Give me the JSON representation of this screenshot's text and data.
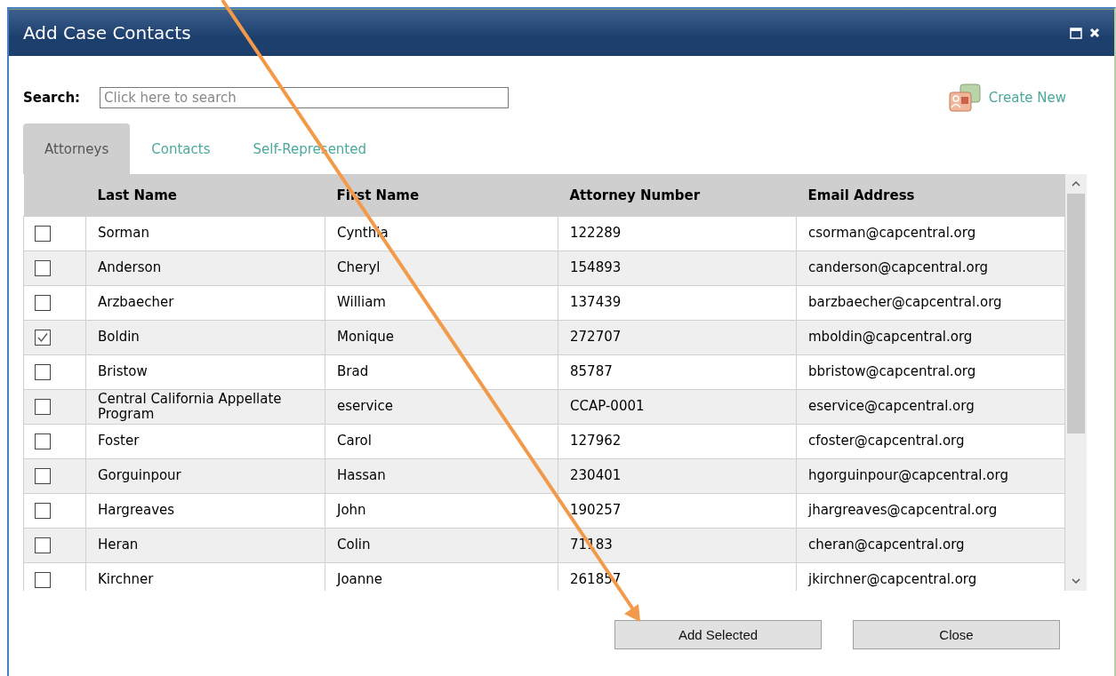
{
  "window": {
    "title": "Add Case Contacts"
  },
  "search": {
    "label": "Search:",
    "placeholder": "Click here to search"
  },
  "create_new": {
    "label": "Create New"
  },
  "tabs": [
    {
      "label": "Attorneys",
      "selected": true
    },
    {
      "label": "Contacts",
      "selected": false
    },
    {
      "label": "Self-Represented",
      "selected": false
    }
  ],
  "table": {
    "columns": [
      "Last Name",
      "First Name",
      "Attorney Number",
      "Email Address"
    ],
    "rows": [
      {
        "checked": false,
        "cells": [
          "Sorman",
          "Cynthia",
          "122289",
          "csorman@capcentral.org"
        ]
      },
      {
        "checked": false,
        "cells": [
          "Anderson",
          "Cheryl",
          "154893",
          "canderson@capcentral.org"
        ]
      },
      {
        "checked": false,
        "cells": [
          "Arzbaecher",
          "William",
          "137439",
          "barzbaecher@capcentral.org"
        ]
      },
      {
        "checked": true,
        "cells": [
          "Boldin",
          "Monique",
          "272707",
          "mboldin@capcentral.org"
        ]
      },
      {
        "checked": false,
        "cells": [
          "Bristow",
          "Brad",
          "85787",
          "bbristow@capcentral.org"
        ]
      },
      {
        "checked": false,
        "cells": [
          "Central California Appellate Program",
          "eservice",
          "CCAP-0001",
          "eservice@capcentral.org"
        ]
      },
      {
        "checked": false,
        "cells": [
          "Foster",
          "Carol",
          "127962",
          "cfoster@capcentral.org"
        ]
      },
      {
        "checked": false,
        "cells": [
          "Gorguinpour",
          "Hassan",
          "230401",
          "hgorguinpour@capcentral.org"
        ]
      },
      {
        "checked": false,
        "cells": [
          "Hargreaves",
          "John",
          "190257",
          "jhargreaves@capcentral.org"
        ]
      },
      {
        "checked": false,
        "cells": [
          "Heran",
          "Colin",
          "71183",
          "cheran@capcentral.org"
        ]
      },
      {
        "checked": false,
        "cells": [
          "Kirchner",
          "Joanne",
          "261857",
          "jkirchner@capcentral.org"
        ]
      }
    ]
  },
  "buttons": [
    "Add Selected",
    "Close"
  ]
}
